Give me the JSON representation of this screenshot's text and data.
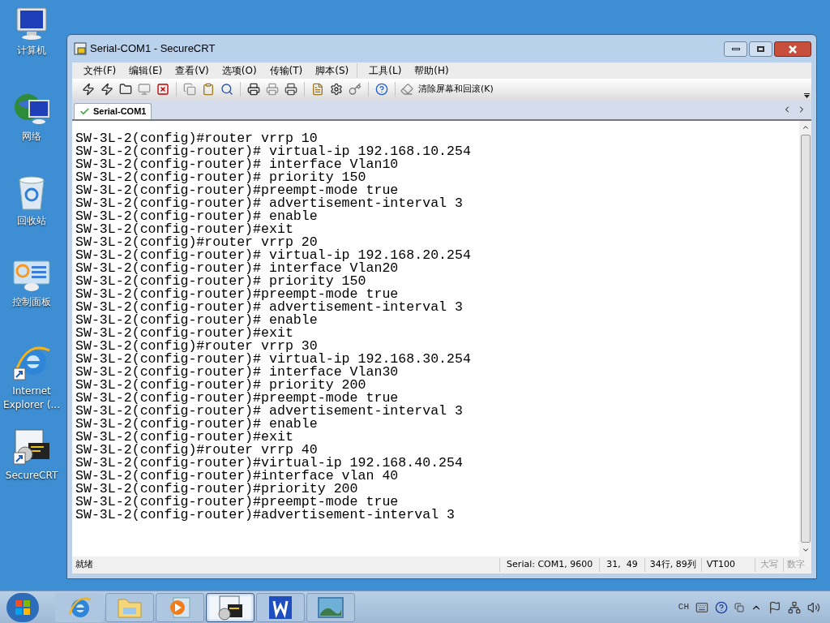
{
  "desktop_icons": [
    {
      "kind": "computer",
      "label": "计算机"
    },
    {
      "kind": "network",
      "label": "网络"
    },
    {
      "kind": "recycle",
      "label": "回收站"
    },
    {
      "kind": "control",
      "label": "控制面板"
    },
    {
      "kind": "ie",
      "label": "Internet Explorer (..."
    },
    {
      "kind": "securecrt",
      "label": "SecureCRT"
    }
  ],
  "window": {
    "title": "Serial-COM1 - SecureCRT",
    "menu_groups": [
      [
        "文件(F)",
        "编辑(E)",
        "查看(V)",
        "选项(O)",
        "传输(T)",
        "脚本(S)"
      ],
      [
        "工具(L)",
        "帮助(H)"
      ]
    ],
    "toolbar": {
      "clear_button": "清除屏幕和回滚(K)"
    },
    "tabs": [
      {
        "label": "Serial-COM1",
        "selected": true
      }
    ],
    "terminal_lines": [
      "SW-3L-2(config)#router vrrp 10",
      "SW-3L-2(config-router)# virtual-ip 192.168.10.254",
      "SW-3L-2(config-router)# interface Vlan10",
      "SW-3L-2(config-router)# priority 150",
      "SW-3L-2(config-router)#preempt-mode true",
      "SW-3L-2(config-router)# advertisement-interval 3",
      "SW-3L-2(config-router)# enable",
      "SW-3L-2(config-router)#exit",
      "SW-3L-2(config)#router vrrp 20",
      "SW-3L-2(config-router)# virtual-ip 192.168.20.254",
      "SW-3L-2(config-router)# interface Vlan20",
      "SW-3L-2(config-router)# priority 150",
      "SW-3L-2(config-router)#preempt-mode true",
      "SW-3L-2(config-router)# advertisement-interval 3",
      "SW-3L-2(config-router)# enable",
      "SW-3L-2(config-router)#exit",
      "SW-3L-2(config)#router vrrp 30",
      "SW-3L-2(config-router)# virtual-ip 192.168.30.254",
      "SW-3L-2(config-router)# interface Vlan30",
      "SW-3L-2(config-router)# priority 200",
      "SW-3L-2(config-router)#preempt-mode true",
      "SW-3L-2(config-router)# advertisement-interval 3",
      "SW-3L-2(config-router)# enable",
      "SW-3L-2(config-router)#exit",
      "SW-3L-2(config)#router vrrp 40",
      "SW-3L-2(config-router)#virtual-ip 192.168.40.254",
      "SW-3L-2(config-router)#interface vlan 40",
      "SW-3L-2(config-router)#priority 200",
      "SW-3L-2(config-router)#preempt-mode true",
      "SW-3L-2(config-router)#advertisement-interval 3"
    ],
    "status_bar": {
      "message": "就绪",
      "connection": "Serial: COM1, 9600",
      "cursor": "31,  49",
      "size": "34行, 89列",
      "emulation": "VT100",
      "caps": "大写",
      "num": "数字"
    }
  },
  "taskbar": {
    "items": [
      {
        "kind": "ie",
        "selected": false
      },
      {
        "kind": "folder",
        "selected": false
      },
      {
        "kind": "media",
        "selected": false
      },
      {
        "kind": "securecrt",
        "selected": true
      },
      {
        "kind": "wps",
        "selected": false
      },
      {
        "kind": "photo",
        "selected": false
      }
    ],
    "language": "CH"
  }
}
